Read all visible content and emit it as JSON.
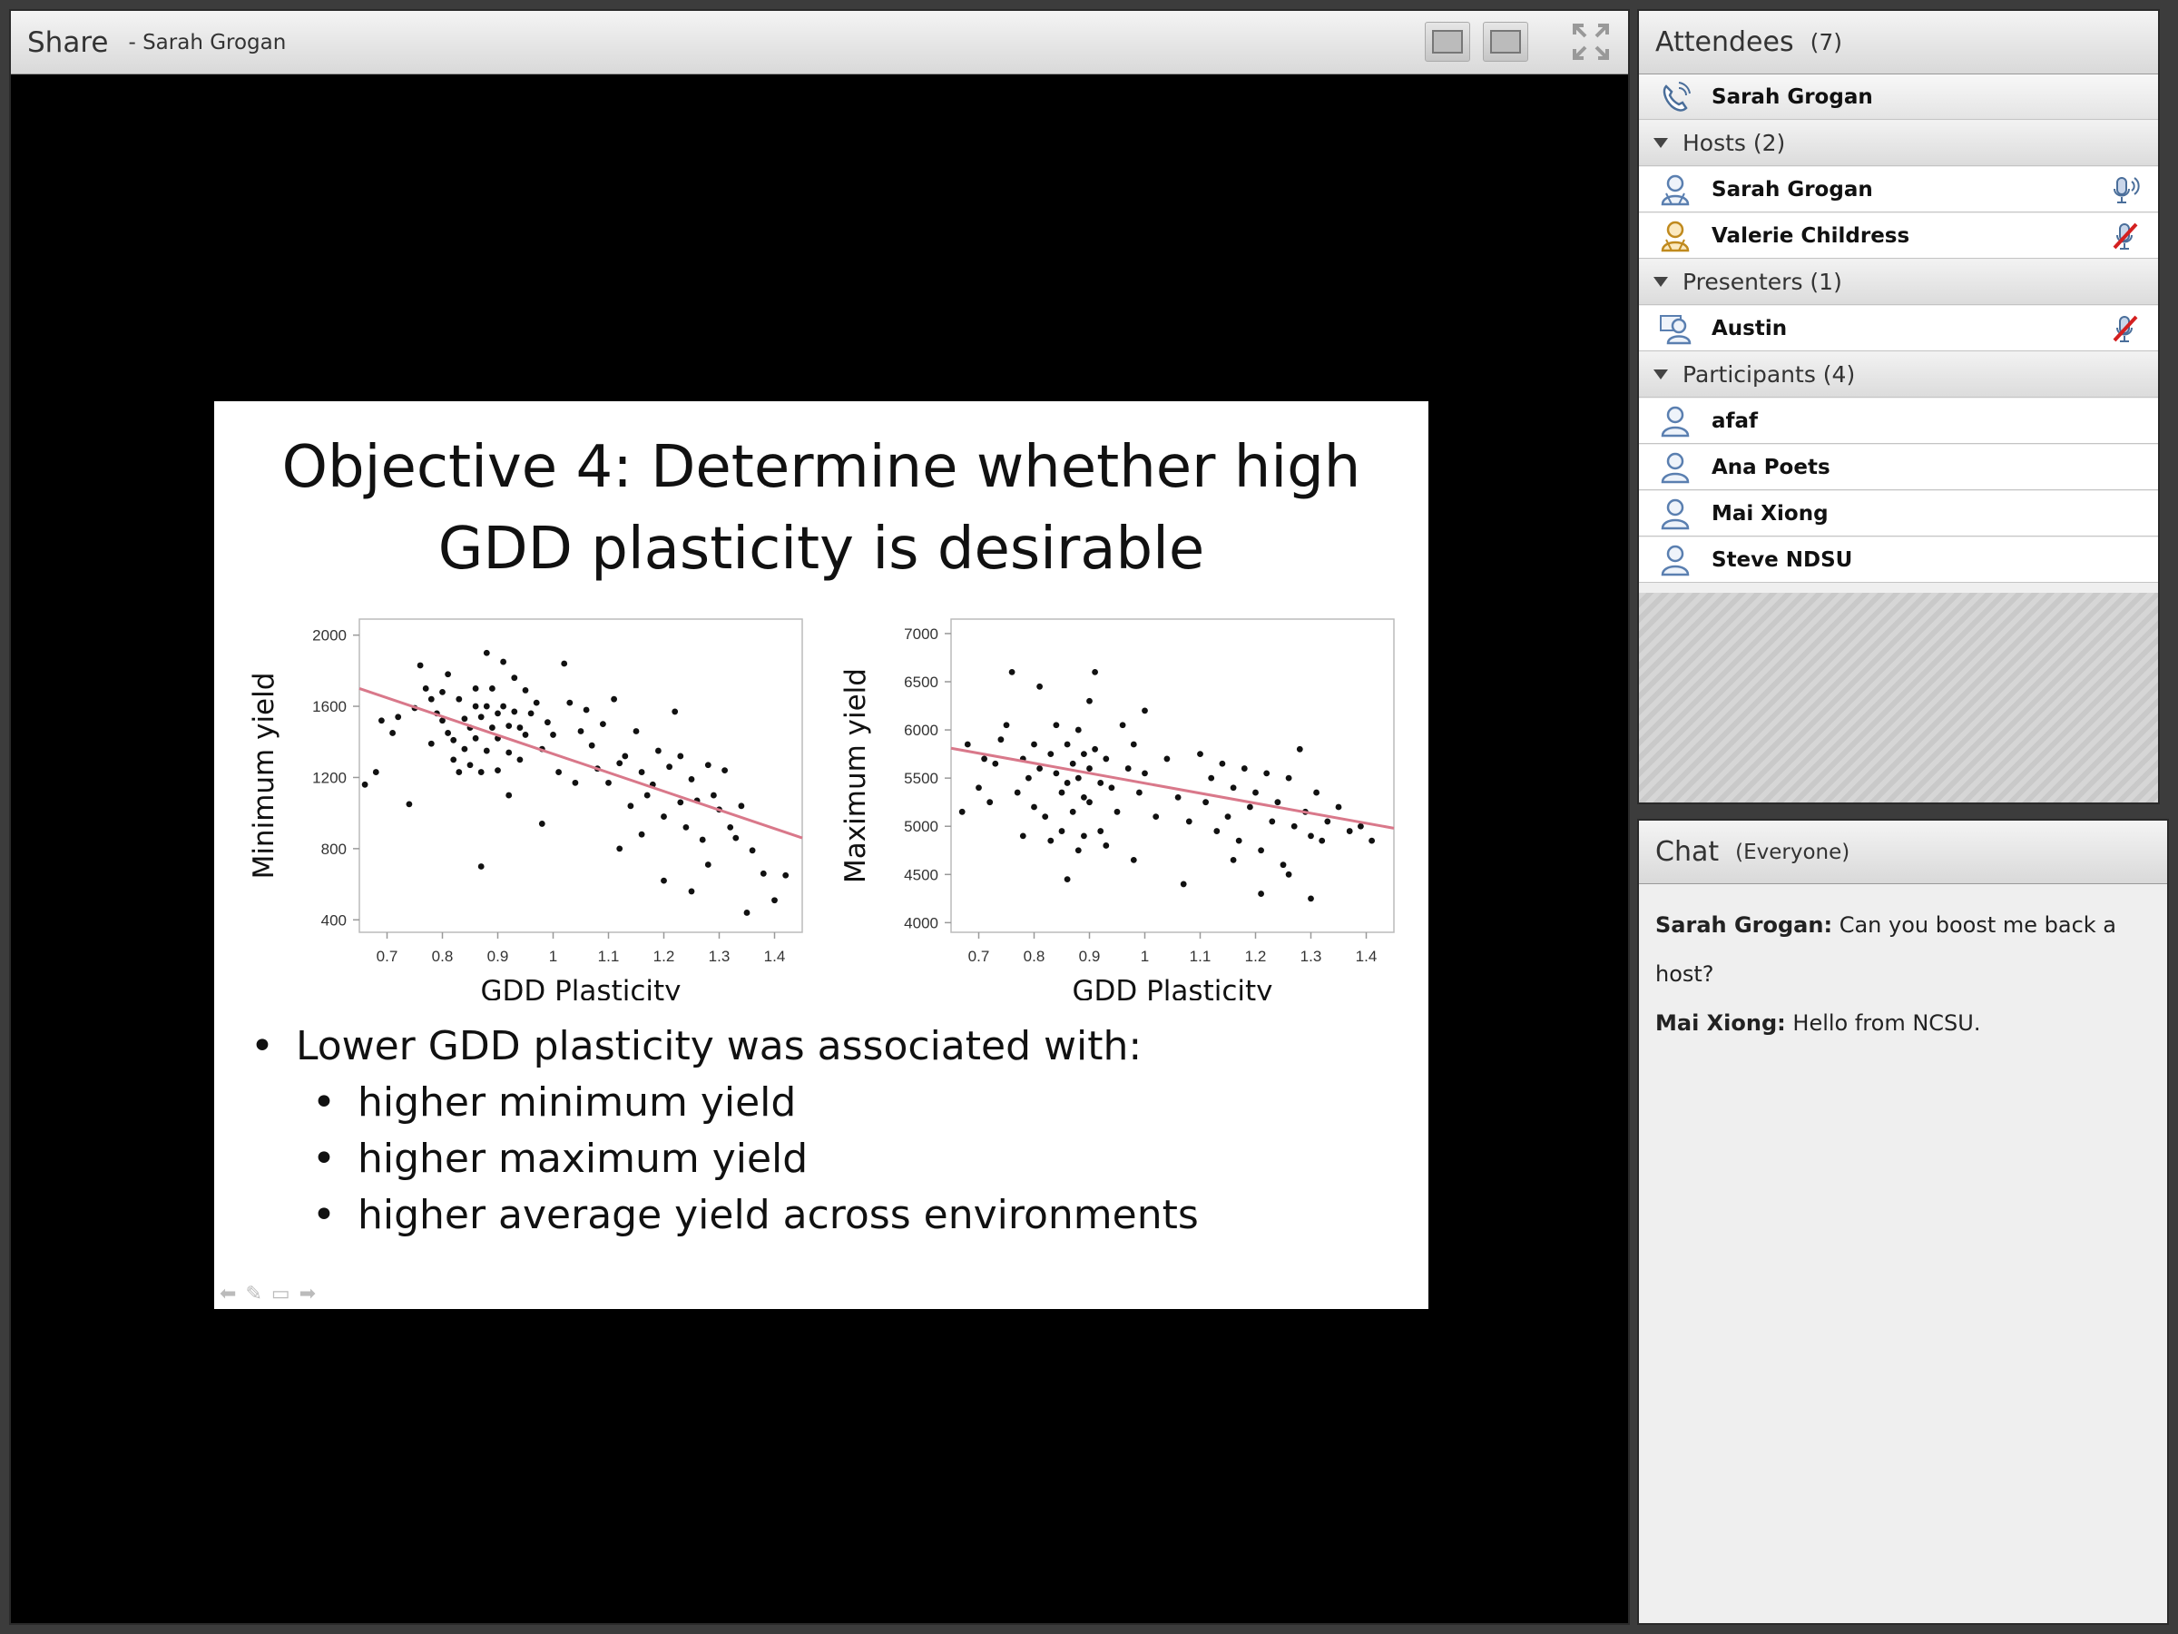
{
  "share": {
    "title": "Share",
    "subtitle": "- Sarah Grogan"
  },
  "slide": {
    "title_line1": "Objective 4: Determine whether high",
    "title_line2": "GDD plasticity is desirable",
    "bullet_main": "Lower GDD plasticity was associated with:",
    "bullets_sub": [
      "higher minimum yield",
      "higher maximum yield",
      "higher average yield across environments"
    ]
  },
  "chart_data": [
    {
      "type": "scatter",
      "xlabel": "GDD Plasticity",
      "ylabel": "Minimum yield",
      "xticks": [
        "0.7",
        "0.8",
        "0.9",
        "1",
        "1.1",
        "1.2",
        "1.3",
        "1.4"
      ],
      "yticks": [
        "400",
        "800",
        "1200",
        "1600",
        "2000"
      ],
      "xlim": [
        0.65,
        1.45
      ],
      "ylim": [
        330,
        2090
      ],
      "trend_line": {
        "x": [
          0.65,
          1.45
        ],
        "y": [
          1700,
          860
        ],
        "color": "#d9788a"
      },
      "points": {
        "x": [
          0.66,
          0.68,
          0.69,
          0.71,
          0.72,
          0.74,
          0.75,
          0.76,
          0.77,
          0.78,
          0.78,
          0.79,
          0.8,
          0.8,
          0.81,
          0.81,
          0.82,
          0.82,
          0.83,
          0.83,
          0.84,
          0.84,
          0.85,
          0.85,
          0.86,
          0.86,
          0.86,
          0.87,
          0.87,
          0.88,
          0.88,
          0.88,
          0.89,
          0.89,
          0.9,
          0.9,
          0.9,
          0.91,
          0.91,
          0.92,
          0.92,
          0.93,
          0.93,
          0.94,
          0.94,
          0.95,
          0.95,
          0.96,
          0.97,
          0.98,
          0.99,
          1.0,
          1.01,
          1.02,
          1.03,
          1.04,
          1.05,
          1.06,
          1.07,
          1.08,
          1.09,
          1.1,
          1.11,
          1.12,
          1.13,
          1.14,
          1.15,
          1.16,
          1.17,
          1.18,
          1.19,
          1.2,
          1.21,
          1.22,
          1.23,
          1.24,
          1.25,
          1.26,
          1.27,
          1.28,
          1.29,
          1.3,
          1.31,
          1.32,
          1.33,
          1.34,
          1.36,
          1.38,
          1.4,
          1.42,
          0.87,
          0.92,
          0.98,
          1.12,
          1.2,
          1.25,
          1.28,
          1.35,
          1.16,
          1.23
        ],
        "y": [
          1160,
          1230,
          1520,
          1450,
          1540,
          1050,
          1590,
          1830,
          1700,
          1640,
          1390,
          1560,
          1520,
          1680,
          1450,
          1780,
          1410,
          1300,
          1230,
          1640,
          1530,
          1360,
          1480,
          1270,
          1700,
          1600,
          1420,
          1540,
          1230,
          1900,
          1600,
          1350,
          1480,
          1700,
          1560,
          1420,
          1240,
          1850,
          1600,
          1490,
          1340,
          1760,
          1570,
          1480,
          1300,
          1690,
          1440,
          1560,
          1620,
          1360,
          1510,
          1440,
          1230,
          1840,
          1620,
          1170,
          1460,
          1580,
          1380,
          1250,
          1500,
          1170,
          1640,
          1280,
          1320,
          1040,
          1460,
          1230,
          1100,
          1160,
          1350,
          980,
          1260,
          1570,
          1320,
          920,
          1190,
          1070,
          850,
          1270,
          1100,
          1020,
          1240,
          920,
          860,
          1040,
          790,
          660,
          510,
          650,
          700,
          1100,
          940,
          800,
          620,
          560,
          710,
          440,
          880,
          1060
        ]
      }
    },
    {
      "type": "scatter",
      "xlabel": "GDD Plasticity",
      "ylabel": "Maximum yield",
      "xticks": [
        "0.7",
        "0.8",
        "0.9",
        "1",
        "1.1",
        "1.2",
        "1.3",
        "1.4"
      ],
      "yticks": [
        "4000",
        "4500",
        "5000",
        "5500",
        "6000",
        "6500",
        "7000"
      ],
      "xlim": [
        0.65,
        1.45
      ],
      "ylim": [
        3900,
        7150
      ],
      "trend_line": {
        "x": [
          0.65,
          1.45
        ],
        "y": [
          5810,
          4980
        ],
        "color": "#d9788a"
      },
      "points": {
        "x": [
          0.67,
          0.68,
          0.7,
          0.71,
          0.72,
          0.73,
          0.74,
          0.75,
          0.76,
          0.77,
          0.78,
          0.78,
          0.79,
          0.8,
          0.8,
          0.81,
          0.81,
          0.82,
          0.83,
          0.83,
          0.84,
          0.84,
          0.85,
          0.85,
          0.86,
          0.86,
          0.87,
          0.87,
          0.88,
          0.88,
          0.88,
          0.89,
          0.89,
          0.9,
          0.9,
          0.9,
          0.91,
          0.91,
          0.92,
          0.92,
          0.93,
          0.94,
          0.95,
          0.96,
          0.97,
          0.98,
          0.99,
          1.0,
          1.02,
          1.04,
          1.06,
          1.08,
          1.1,
          1.11,
          1.12,
          1.13,
          1.14,
          1.15,
          1.16,
          1.17,
          1.18,
          1.19,
          1.2,
          1.21,
          1.22,
          1.23,
          1.24,
          1.25,
          1.26,
          1.27,
          1.28,
          1.29,
          1.3,
          1.31,
          1.32,
          1.33,
          1.35,
          1.37,
          1.39,
          1.41,
          0.86,
          0.89,
          0.93,
          0.98,
          1.0,
          1.07,
          1.16,
          1.21,
          1.26,
          1.3
        ],
        "y": [
          5150,
          5850,
          5400,
          5700,
          5250,
          5650,
          5900,
          6050,
          6600,
          5350,
          5700,
          4900,
          5500,
          5850,
          5200,
          6450,
          5600,
          5100,
          5750,
          4850,
          5550,
          6050,
          5350,
          4950,
          5850,
          5450,
          5650,
          5150,
          6000,
          5500,
          4750,
          5750,
          5300,
          6300,
          5600,
          5250,
          6600,
          5800,
          5450,
          4950,
          5700,
          5400,
          5150,
          6050,
          5600,
          5850,
          5350,
          5550,
          5100,
          5700,
          5300,
          5050,
          5750,
          5250,
          5500,
          4950,
          5650,
          5100,
          5400,
          4850,
          5600,
          5200,
          5350,
          4750,
          5550,
          5050,
          5250,
          4600,
          5500,
          5000,
          5800,
          5150,
          4900,
          5350,
          4850,
          5050,
          5200,
          4950,
          5000,
          4850,
          4450,
          4900,
          4800,
          4650,
          6200,
          4400,
          4650,
          4300,
          4500,
          4250
        ]
      }
    }
  ],
  "attendees": {
    "title": "Attendees",
    "count": "(7)",
    "self_name": "Sarah Grogan",
    "hosts_label": "Hosts (2)",
    "hosts": [
      {
        "name": "Sarah Grogan"
      },
      {
        "name": "Valerie Childress"
      }
    ],
    "presenters_label": "Presenters (1)",
    "presenters": [
      {
        "name": "Austin"
      }
    ],
    "participants_label": "Participants (4)",
    "participants": [
      {
        "name": "afaf"
      },
      {
        "name": "Ana Poets"
      },
      {
        "name": "Mai Xiong"
      },
      {
        "name": "Steve NDSU"
      }
    ]
  },
  "chat": {
    "title": "Chat",
    "subtitle": "(Everyone)",
    "messages": [
      {
        "sender": "Sarah Grogan:",
        "text": "Can you boost me back a host?"
      },
      {
        "sender": "Mai Xiong:",
        "text": "Hello from NCSU."
      }
    ]
  },
  "colors": {
    "trend": "#d9788a",
    "host_icon": "#d9a12a",
    "user_icon": "#5a7fb0",
    "mic_muted": "#d42020"
  },
  "icons": {
    "phone": "phone-icon",
    "user": "user-icon",
    "microphone": "microphone-icon",
    "microphone_muted": "microphone-muted-icon",
    "fullscreen": "fullscreen-icon"
  }
}
